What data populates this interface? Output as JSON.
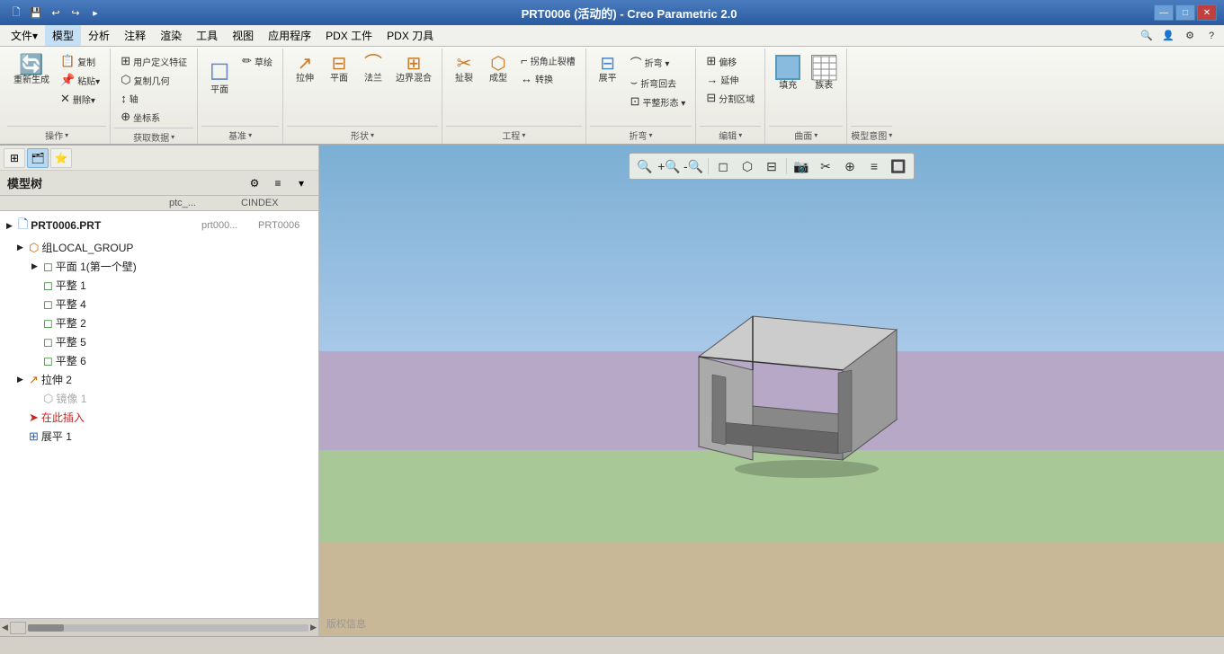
{
  "titleBar": {
    "title": "PRT0006  (活动的) - Creo Parametric 2.0",
    "quickAccess": [
      "🖹",
      "💾",
      "↩",
      "↪",
      "⚙"
    ],
    "winControls": [
      "—",
      "□",
      "✕"
    ]
  },
  "menuBar": {
    "items": [
      "文件▾",
      "模型",
      "分析",
      "注释",
      "渲染",
      "工具",
      "视图",
      "应用程序",
      "PDX 工件",
      "PDX 刀具"
    ]
  },
  "ribbon": {
    "groups": [
      {
        "label": "操作",
        "buttons_large": [
          {
            "icon": "🔄",
            "label": "重新生成"
          }
        ],
        "buttons_small": [
          [
            "复制",
            "粘贴▾",
            "删除▾"
          ],
          [
            "",
            "",
            ""
          ]
        ]
      },
      {
        "label": "获取数据",
        "buttons_small": [
          [
            "用户定义特征",
            "轴",
            "坐标系"
          ],
          [
            "复制几何",
            "",
            ""
          ]
        ]
      },
      {
        "label": "基准",
        "buttons_large": [
          {
            "icon": "◻",
            "label": "平面"
          }
        ],
        "buttons_small": [
          [
            "草绘",
            "",
            ""
          ]
        ]
      },
      {
        "label": "形状",
        "buttons_large": [
          {
            "icon": "↗",
            "label": "拉伸"
          },
          {
            "icon": "⌣",
            "label": "平面"
          },
          {
            "icon": "⌢",
            "label": "法兰"
          },
          {
            "icon": "⊡",
            "label": "边界混合"
          }
        ]
      },
      {
        "label": "工程",
        "buttons_large": [
          {
            "icon": "✂",
            "label": "扯裂"
          },
          {
            "icon": "⬡",
            "label": "成型"
          }
        ],
        "buttons_small": [
          [
            "拐角止裂槽",
            "转换"
          ]
        ]
      },
      {
        "label": "折弯",
        "buttons_large": [
          {
            "icon": "⌒",
            "label": "展平"
          }
        ],
        "buttons_small": [
          [
            "折弯▾",
            "折弯回去",
            "平整形态▾"
          ]
        ]
      },
      {
        "label": "编辑",
        "buttons_small": [
          [
            "偏移",
            "延伸",
            "分割区域"
          ]
        ]
      },
      {
        "label": "曲面",
        "buttons_large": [
          {
            "icon": "□",
            "label": "填充"
          },
          {
            "icon": "▦",
            "label": "族表"
          }
        ]
      },
      {
        "label": "模型意图"
      }
    ]
  },
  "sidebar": {
    "title": "模型树",
    "iconButtons": [
      "⊞",
      "🖹",
      "⭐"
    ],
    "treeHeader": [
      "ptc_...",
      "CINDEX"
    ],
    "items": [
      {
        "indent": 0,
        "expand": true,
        "icon": "🗋",
        "color": "blue",
        "label": "PRT0006.PRT",
        "col1": "prt000...",
        "col2": "PRT0006"
      },
      {
        "indent": 1,
        "expand": true,
        "icon": "🔗",
        "color": "orange",
        "label": "组LOCAL_GROUP",
        "col1": "",
        "col2": ""
      },
      {
        "indent": 2,
        "expand": true,
        "icon": "◻",
        "color": "green",
        "label": "平面 1(第一个壁)",
        "col1": "",
        "col2": ""
      },
      {
        "indent": 2,
        "expand": false,
        "icon": "◻",
        "color": "green",
        "label": "平整 1",
        "col1": "",
        "col2": ""
      },
      {
        "indent": 2,
        "expand": false,
        "icon": "◻",
        "color": "green",
        "label": "平整 4",
        "col1": "",
        "col2": ""
      },
      {
        "indent": 2,
        "expand": false,
        "icon": "◻",
        "color": "green",
        "label": "平整 2",
        "col1": "",
        "col2": ""
      },
      {
        "indent": 2,
        "expand": false,
        "icon": "◻",
        "color": "green",
        "label": "平整 5",
        "col1": "",
        "col2": ""
      },
      {
        "indent": 2,
        "expand": false,
        "icon": "◻",
        "color": "green",
        "label": "平整 6",
        "col1": "",
        "col2": ""
      },
      {
        "indent": 1,
        "expand": true,
        "icon": "↗",
        "color": "orange",
        "label": "拉伸 2",
        "col1": "",
        "col2": ""
      },
      {
        "indent": 2,
        "expand": false,
        "icon": "⬡",
        "color": "gray",
        "label": "镜像 1",
        "col1": "",
        "col2": ""
      },
      {
        "indent": 1,
        "expand": false,
        "icon": "➤",
        "color": "red",
        "label": "在此插入",
        "col1": "",
        "col2": ""
      },
      {
        "indent": 1,
        "expand": false,
        "icon": "⊞",
        "color": "blue",
        "label": "展平 1",
        "col1": "",
        "col2": ""
      }
    ]
  },
  "viewportToolbar": {
    "buttons": [
      "🔍",
      "🔍+",
      "🔍-",
      "◻",
      "⬡",
      "⊡",
      "📷",
      "✂",
      "⊕",
      "≡",
      "🔲"
    ]
  },
  "viewport": {
    "watermark": "版权信息"
  },
  "statusBar": {
    "text": ""
  }
}
